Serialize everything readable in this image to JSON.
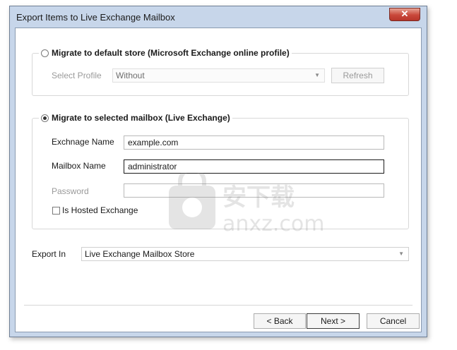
{
  "window": {
    "title": "Export Items to Live Exchange Mailbox",
    "close_label": "✕"
  },
  "option_default": {
    "legend": "Migrate to default store (Microsoft Exchange online profile)",
    "select_profile_label": "Select Profile",
    "select_profile_value": "Without",
    "refresh_label": "Refresh"
  },
  "option_selected": {
    "legend": "Migrate to selected mailbox (Live Exchange)",
    "exchange_name_label": "Exchnage Name",
    "exchange_name_value": "example.com",
    "mailbox_name_label": "Mailbox Name",
    "mailbox_name_value": "administrator",
    "password_label": "Password",
    "password_value": "",
    "hosted_label": "Is Hosted Exchange"
  },
  "export_in": {
    "label": "Export In",
    "value": "Live Exchange Mailbox Store"
  },
  "buttons": {
    "back": "< Back",
    "next": "Next >",
    "cancel": "Cancel"
  },
  "watermark": {
    "cn": "安下载",
    "en": "anxz.com"
  }
}
